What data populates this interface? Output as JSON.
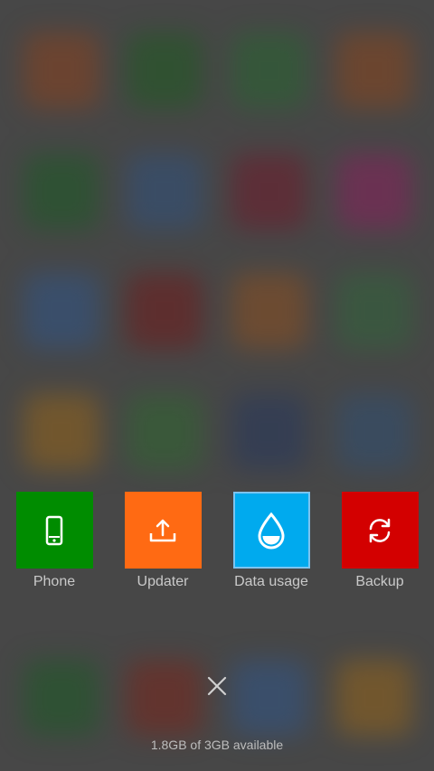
{
  "tiles": [
    {
      "label": "Phone",
      "icon": "phone-icon",
      "color": "#008c00"
    },
    {
      "label": "Updater",
      "icon": "upload-icon",
      "color": "#ff6a13"
    },
    {
      "label": "Data usage",
      "icon": "water-drop-icon",
      "color": "#00aaee",
      "selected": true
    },
    {
      "label": "Backup",
      "icon": "sync-icon",
      "color": "#d30000"
    }
  ],
  "close_icon": "close-icon",
  "storage_text": "1.8GB of 3GB available",
  "background_colors": [
    "#b2460e",
    "#0e6a12",
    "#1d7a2a",
    "#b34a0c",
    "#0b6a1a",
    "#2a5ca0",
    "#8b0a22",
    "#b0136e",
    "#2a62b0",
    "#8c0a0a",
    "#b65a12",
    "#2b7a3a",
    "#c47a08",
    "#2a7e2a",
    "#1c3470",
    "#2a5a90",
    "#0b6a1a",
    "#9a1a0a",
    "#2a62b0",
    "#c47a08"
  ]
}
